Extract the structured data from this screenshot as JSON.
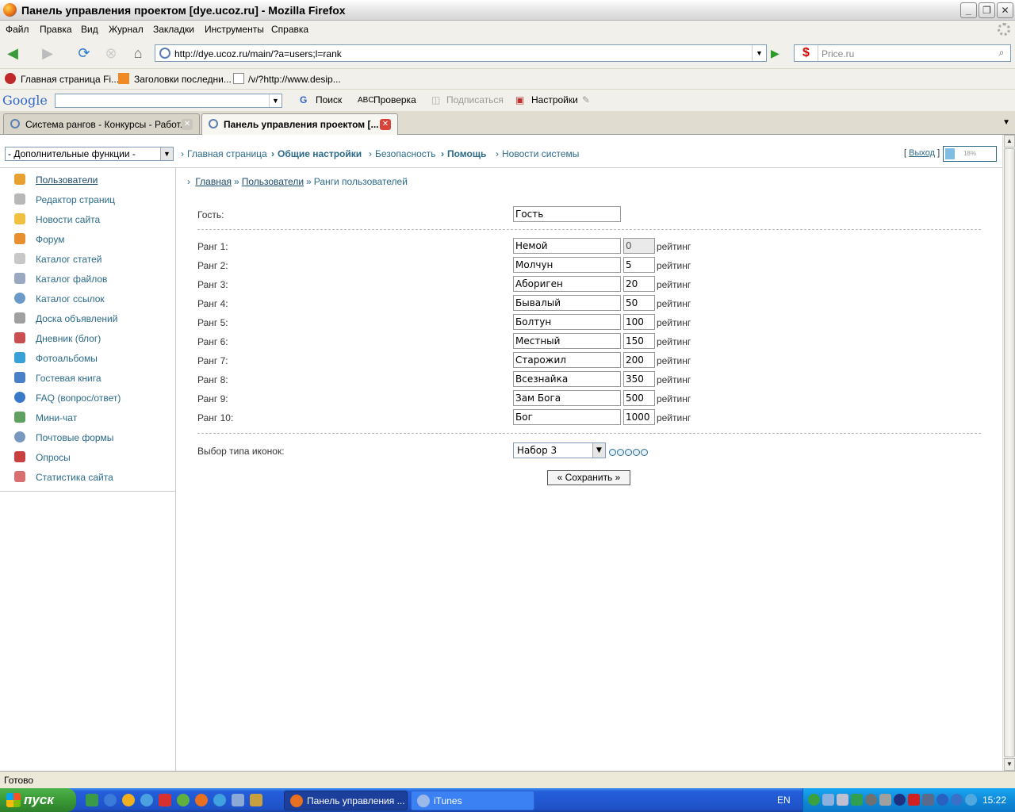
{
  "window": {
    "title": "Панель управления проектом [dye.ucoz.ru] - Mozilla Firefox"
  },
  "menu": [
    "Файл",
    "Правка",
    "Вид",
    "Журнал",
    "Закладки",
    "Инструменты",
    "Справка"
  ],
  "address": {
    "url": "http://dye.ucoz.ru/main/?a=users;l=rank"
  },
  "search": {
    "placeholder": "Price.ru"
  },
  "bookmarks": [
    "Главная страница Fi...",
    "Заголовки последни...",
    "/v/?http://www.desip..."
  ],
  "googlebar": {
    "logo": "Google",
    "search": "Поиск",
    "spell": "Проверка",
    "subscribe": "Подписаться",
    "settings": "Настройки"
  },
  "tabs": [
    {
      "label": "Система рангов - Конкурсы - Работ..."
    },
    {
      "label": "Панель управления проектом [..."
    }
  ],
  "adminnav": {
    "func_select": "- Дополнительные функции -",
    "links": [
      "Главная страница",
      "Общие настройки",
      "Безопасность",
      "Помощь",
      "Новости системы"
    ],
    "logout_open": "[",
    "logout": "Выход",
    "logout_close": "]",
    "quota": "18%",
    "quota_fraction": 0.18
  },
  "sidebar": [
    "Пользователи",
    "Редактор страниц",
    "Новости сайта",
    "Форум",
    "Каталог статей",
    "Каталог файлов",
    "Каталог ссылок",
    "Доска объявлений",
    "Дневник (блог)",
    "Фотоальбомы",
    "Гостевая книга",
    "FAQ (вопрос/ответ)",
    "Мини-чат",
    "Почтовые формы",
    "Опросы",
    "Статистика сайта"
  ],
  "breadcrumb": {
    "home": "Главная",
    "sep": "»",
    "users": "Пользователи",
    "current": "Ранги пользователей"
  },
  "guest": {
    "label": "Гость:",
    "value": "Гость"
  },
  "ranks": [
    {
      "label": "Ранг 1:",
      "name": "Немой",
      "rating": "0"
    },
    {
      "label": "Ранг 2:",
      "name": "Молчун",
      "rating": "5"
    },
    {
      "label": "Ранг 3:",
      "name": "Абориген",
      "rating": "20"
    },
    {
      "label": "Ранг 4:",
      "name": "Бывалый",
      "rating": "50"
    },
    {
      "label": "Ранг 5:",
      "name": "Болтун",
      "rating": "100"
    },
    {
      "label": "Ранг 6:",
      "name": "Местный",
      "rating": "150"
    },
    {
      "label": "Ранг 7:",
      "name": "Старожил",
      "rating": "200"
    },
    {
      "label": "Ранг 8:",
      "name": "Всезнайка",
      "rating": "350"
    },
    {
      "label": "Ранг 9:",
      "name": "Зам Бога",
      "rating": "500"
    },
    {
      "label": "Ранг 10:",
      "name": "Бог",
      "rating": "1000"
    }
  ],
  "rating_unit": "рейтинг",
  "icons": {
    "label": "Выбор типа иконок:",
    "selected": "Набор 3"
  },
  "save_label": "« Сохранить »",
  "status": "Готово",
  "taskbar": {
    "start": "пуск",
    "windows": [
      "Панель управления ...",
      "iTunes"
    ],
    "lang": "EN",
    "clock": "15:22"
  }
}
